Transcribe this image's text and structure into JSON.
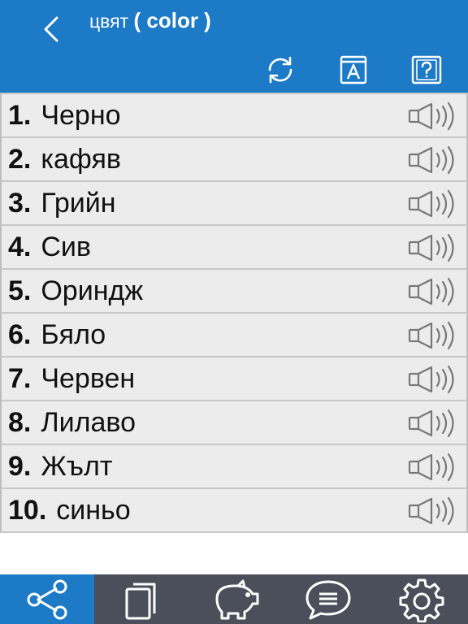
{
  "header": {
    "title_native": "цвят",
    "title_en": "( color )",
    "back_icon": "chevron-left-icon",
    "buttons": [
      {
        "name": "refresh-button",
        "icon": "refresh-icon"
      },
      {
        "name": "dictionary-button",
        "icon": "book-a-icon"
      },
      {
        "name": "quiz-button",
        "icon": "question-box-icon"
      }
    ]
  },
  "words": [
    {
      "num": "1.",
      "word": "Черно"
    },
    {
      "num": "2.",
      "word": "кафяв"
    },
    {
      "num": "3.",
      "word": "Грийн"
    },
    {
      "num": "4.",
      "word": "Сив"
    },
    {
      "num": "5.",
      "word": "Ориндж"
    },
    {
      "num": "6.",
      "word": "Бяло"
    },
    {
      "num": "7.",
      "word": "Червен"
    },
    {
      "num": "8.",
      "word": "Лилаво"
    },
    {
      "num": "9.",
      "word": "Жълт"
    },
    {
      "num": "10.",
      "word": "синьо"
    }
  ],
  "tabbar": {
    "active_index": 0,
    "tabs": [
      {
        "name": "tab-share",
        "icon": "share-icon"
      },
      {
        "name": "tab-cards",
        "icon": "cards-icon"
      },
      {
        "name": "tab-piggy-bank",
        "icon": "piggy-bank-icon"
      },
      {
        "name": "tab-chat",
        "icon": "chat-icon"
      },
      {
        "name": "tab-settings",
        "icon": "gear-icon"
      }
    ]
  },
  "colors": {
    "header": "#1c7ac6",
    "row_bg": "#ececec",
    "tabbar_bg": "#4a4f5a",
    "active_tab": "#1c7ac6"
  }
}
